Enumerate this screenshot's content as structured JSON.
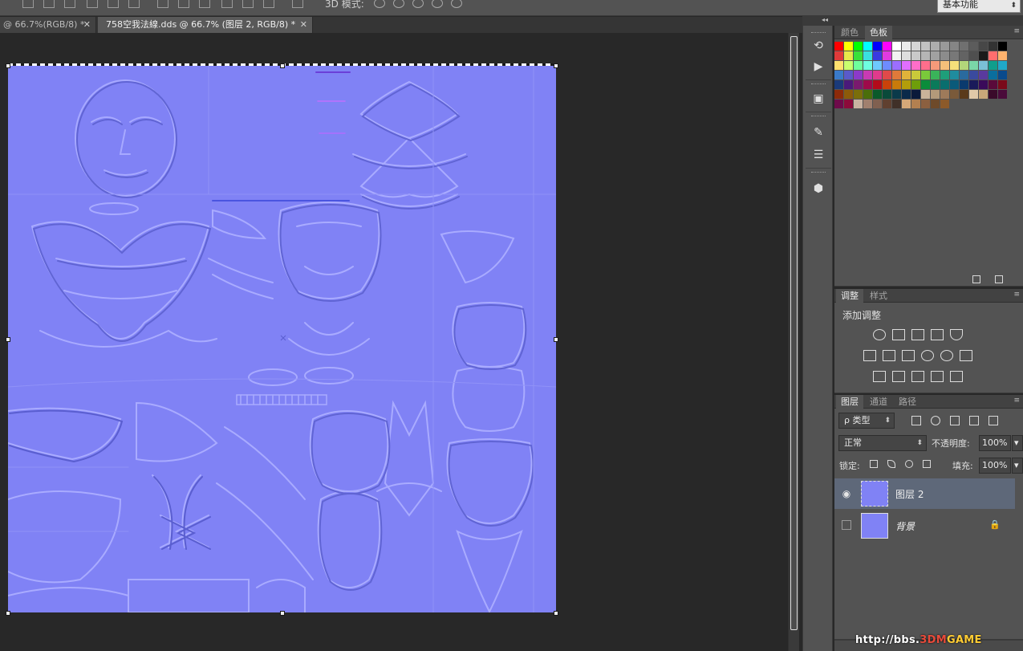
{
  "options_bar": {
    "mode3d_label": "3D 模式:",
    "workspace": "基本功能",
    "workspace_arrow": "⬍"
  },
  "tabs": [
    {
      "label": "@ 66.7%(RGB/8) *",
      "close": "✕",
      "active": false
    },
    {
      "label": "758空我法線.dds @ 66.7% (图层 2, RGB/8) *",
      "close": "✕",
      "active": true
    }
  ],
  "dock": {
    "collapse_glyph": "◂◂",
    "icons": [
      "history-icon",
      "play-actions-icon",
      "3d-material-icon",
      "brush-tool-icon",
      "adjust-sliders-icon",
      "3d-cube-icon"
    ]
  },
  "swatches_panel": {
    "tabs": [
      "颜色",
      "色板"
    ],
    "active_tab": "色板",
    "menu_glyph": "≡",
    "colors": [
      "#ff0000",
      "#ffff00",
      "#00ff00",
      "#00ffff",
      "#0000ff",
      "#ff00ff",
      "#ffffff",
      "#ebebeb",
      "#d6d6d6",
      "#c2c2c2",
      "#adadad",
      "#999999",
      "#858585",
      "#707070",
      "#5c5c5c",
      "#474747",
      "#333333",
      "#000000",
      "#e03a3a",
      "#e8e84a",
      "#3ae03a",
      "#3ae0e0",
      "#3a3ae0",
      "#e03ae0",
      "#f2f2f2",
      "#dedede",
      "#c9c9c9",
      "#b5b5b5",
      "#a1a1a1",
      "#8c8c8c",
      "#787878",
      "#636363",
      "#4f4f4f",
      "#1a1a1a",
      "#ff6e6e",
      "#ffb36e",
      "#ffe06e",
      "#c9ff6e",
      "#6eff9c",
      "#6effe0",
      "#6ec9ff",
      "#6e8cff",
      "#9c6eff",
      "#e06eff",
      "#ff6ec9",
      "#ff6e8c",
      "#f59a7a",
      "#f5c07a",
      "#f5e07a",
      "#b3d67a",
      "#7ad6a8",
      "#7ac0d6",
      "#0f9e8c",
      "#1fa8c9",
      "#3a7ac9",
      "#5a5ac9",
      "#8c3ac9",
      "#c93ab3",
      "#e03a8c",
      "#e04a4a",
      "#e07a3a",
      "#e0b33a",
      "#c9c93a",
      "#7ac93a",
      "#3ab35a",
      "#1f9e7a",
      "#1f8c9e",
      "#2a6a9e",
      "#3a4a9e",
      "#5a3a9e",
      "#0a6e9e",
      "#0a4a8c",
      "#1a3a7a",
      "#4a1a7a",
      "#7a1a6e",
      "#9e0a4a",
      "#b30a1a",
      "#c9420a",
      "#c97a0a",
      "#b39e0a",
      "#6e9e0a",
      "#0a8c3a",
      "#0a7a5a",
      "#0a6e6e",
      "#0a5a7a",
      "#0a3a6e",
      "#1a1a5a",
      "#3a0a5a",
      "#5a0a3a",
      "#7a0a1a",
      "#8c2a0a",
      "#8c5a0a",
      "#7a6e0a",
      "#4a6e0a",
      "#0a5a2a",
      "#0a4a3a",
      "#0a3a4a",
      "#0a2a4a",
      "#0a1a3a",
      "#c9b39a",
      "#b39a7a",
      "#9e7a5a",
      "#7a5a3a",
      "#5a3a1a",
      "#e0c9a8",
      "#c9a87a",
      "#3a0a2a",
      "#4a0a3a",
      "#6e0a4a",
      "#8c0a3a",
      "#c9b3a1",
      "#a1806e",
      "#806050",
      "#604030",
      "#403028",
      "#d6a878",
      "#b38050",
      "#8c6040",
      "#6e4a2a",
      "#8c5a2a"
    ],
    "footer_icons": [
      "new-swatch-icon",
      "trash-icon"
    ]
  },
  "adjust_panel": {
    "tabs": [
      "调整",
      "样式"
    ],
    "active_tab": "调整",
    "heading": "添加调整",
    "row_icons": [
      [
        "brightness-icon",
        "levels-icon",
        "curves-icon",
        "exposure-icon",
        "vibrance-icon"
      ],
      [
        "hue-saturation-icon",
        "color-balance-icon",
        "black-white-icon",
        "photo-filter-icon",
        "channel-mixer-icon",
        "color-lookup-icon"
      ],
      [
        "invert-icon",
        "posterize-icon",
        "threshold-icon",
        "selective-color-icon",
        "gradient-map-icon"
      ]
    ]
  },
  "layers_panel": {
    "tabs": [
      "图层",
      "通道",
      "路径"
    ],
    "active_tab": "图层",
    "filter_kind": "ρ 类型",
    "blend_mode": "正常",
    "opacity_label": "不透明度:",
    "opacity_value": "100%",
    "lock_label": "锁定:",
    "fill_label": "填充:",
    "fill_value": "100%",
    "dropdown_arrow": "▾",
    "layers": [
      {
        "name": "图层 2",
        "visible": true,
        "selected": true,
        "locked": false
      },
      {
        "name": "背景",
        "visible": false,
        "selected": false,
        "locked": true
      }
    ],
    "eye_glyph": "◉",
    "lock_glyph": "🔒"
  },
  "watermark": {
    "part1": "http://bbs.",
    "part2": "3DM",
    "part3": "GAME"
  }
}
